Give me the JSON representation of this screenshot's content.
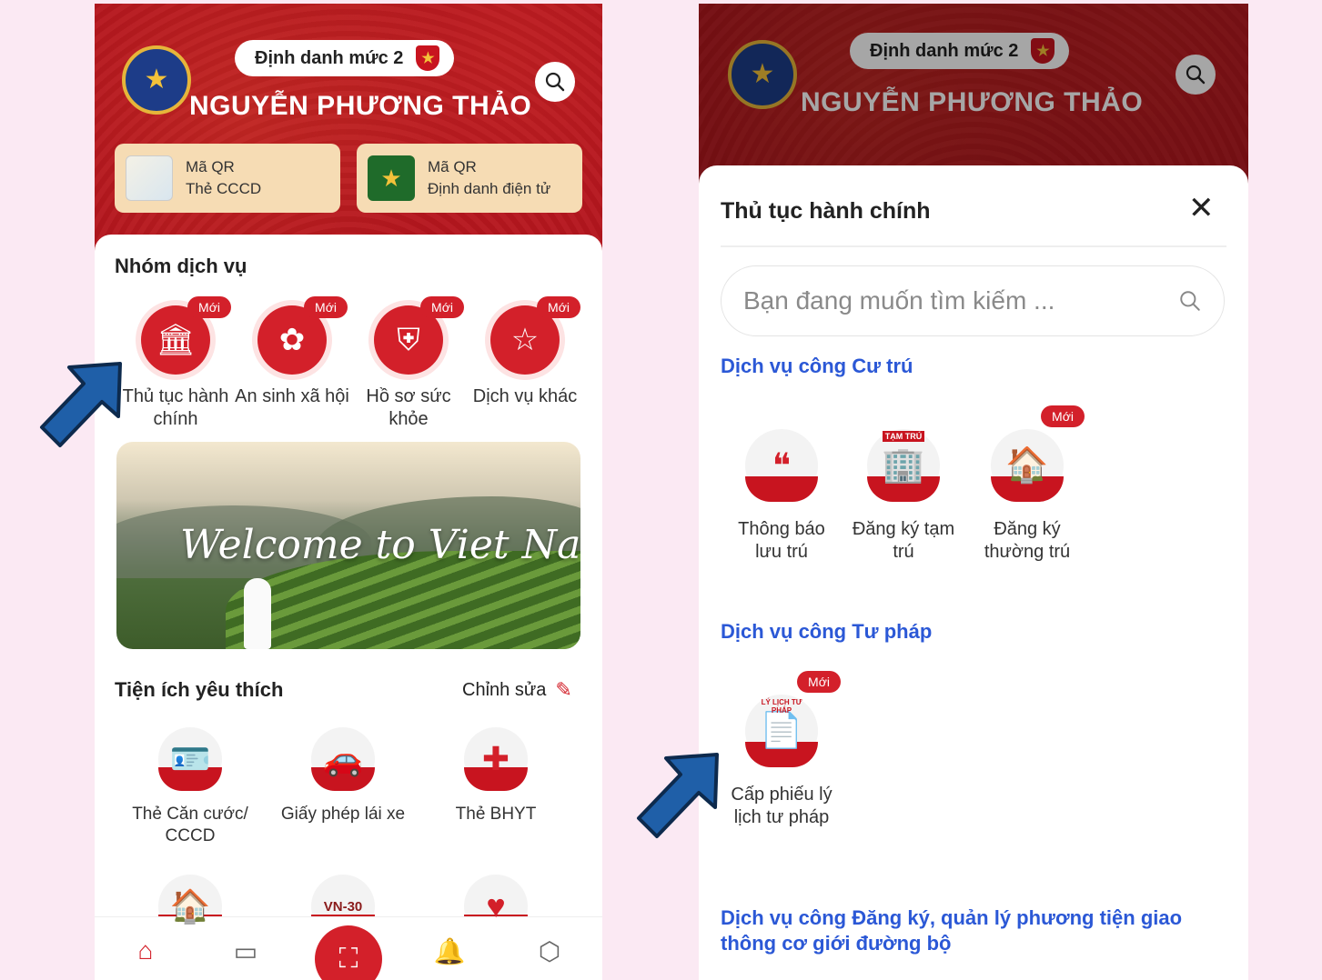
{
  "left": {
    "level_label": "Định danh mức 2",
    "user_name": "NGUYỄN PHƯƠNG THẢO",
    "qr_cards": [
      {
        "line1": "Mã QR",
        "line2": "Thẻ CCCD"
      },
      {
        "line1": "Mã QR",
        "line2": "Định danh điện tử"
      }
    ],
    "service_group_title": "Nhóm dịch vụ",
    "new_badge": "Mới",
    "services": [
      {
        "label": "Thủ tục hành chính",
        "icon": "bank-icon"
      },
      {
        "label": "An sinh xã hội",
        "icon": "care-icon"
      },
      {
        "label": "Hồ sơ sức khỏe",
        "icon": "health-shield-icon"
      },
      {
        "label": "Dịch vụ khác",
        "icon": "star-podium-icon"
      }
    ],
    "banner_text": "Welcome to Viet Nam",
    "favorites_title": "Tiện ích yêu thích",
    "edit_label": "Chỉnh sửa",
    "favorites": [
      {
        "label": "Thẻ Căn cước/ CCCD",
        "icon": "id-card-icon"
      },
      {
        "label": "Giấy phép lái xe",
        "icon": "car-license-icon"
      },
      {
        "label": "Thẻ BHYT",
        "icon": "health-insurance-icon"
      }
    ],
    "partial_favorites": [
      {
        "icon": "house-family-icon"
      },
      {
        "label": "VN-30",
        "icon": "vn30-icon"
      },
      {
        "icon": "hands-heart-icon"
      }
    ]
  },
  "right": {
    "level_label": "Định danh mức 2",
    "user_name": "NGUYỄN PHƯƠNG THẢO",
    "modal_title": "Thủ tục hành chính",
    "search_placeholder": "Bạn đang muốn tìm kiếm ...",
    "new_badge": "Mới",
    "categories": [
      {
        "title": "Dịch vụ công Cư trú",
        "items": [
          {
            "label": "Thông báo lưu trú",
            "icon": "notice-stay-icon"
          },
          {
            "label": "Đăng ký tạm trú",
            "icon": "temp-residence-icon",
            "tag": "TẠM TRÚ"
          },
          {
            "label": "Đăng ký thường trú",
            "icon": "permanent-residence-icon",
            "new": true
          }
        ]
      },
      {
        "title": "Dịch vụ công Tư pháp",
        "items": [
          {
            "label": "Cấp phiếu lý lịch tư pháp",
            "icon": "judicial-record-icon",
            "tag": "LÝ LỊCH TƯ PHÁP",
            "new": true
          }
        ]
      },
      {
        "title": "Dịch vụ công Đăng ký, quản lý phương tiện giao thông cơ giới đường bộ",
        "items": []
      }
    ]
  },
  "colors": {
    "brand_red": "#b3141d",
    "accent_red": "#d3202a",
    "link_blue": "#2b58d6",
    "arrow_blue": "#1f5fa8"
  }
}
